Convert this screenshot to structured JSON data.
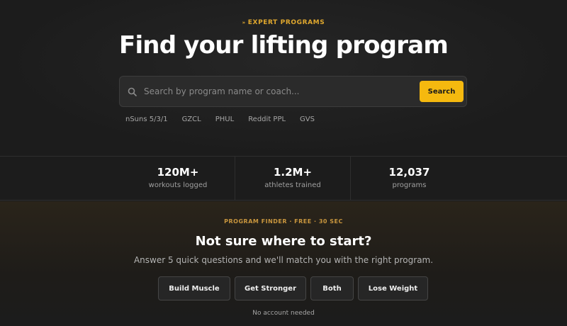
{
  "hero": {
    "eyebrow_mark": "»",
    "eyebrow": "EXPERT PROGRAMS",
    "title": "Find your lifting program",
    "search": {
      "placeholder": "Search by program name or coach...",
      "button_label": "Search",
      "icon": "search-icon"
    },
    "chips": [
      "nSuns 5/3/1",
      "GZCL",
      "PHUL",
      "Reddit PPL",
      "GVS"
    ]
  },
  "stats": [
    {
      "value": "120M+",
      "label": "workouts logged"
    },
    {
      "value": "1.2M+",
      "label": "athletes trained"
    },
    {
      "value": "12,037",
      "label": "programs"
    }
  ],
  "finder": {
    "kicker": "PROGRAM FINDER · FREE · 30 SEC",
    "title": "Not sure where to start?",
    "subtitle": "Answer 5 quick questions and we'll match you with the right program.",
    "options": [
      "Build Muscle",
      "Get Stronger",
      "Both",
      "Lose Weight"
    ],
    "note": "No account needed"
  },
  "colors": {
    "accent": "#f5b90f",
    "eyebrow": "#e0a82e",
    "background": "#1c1c1c"
  }
}
